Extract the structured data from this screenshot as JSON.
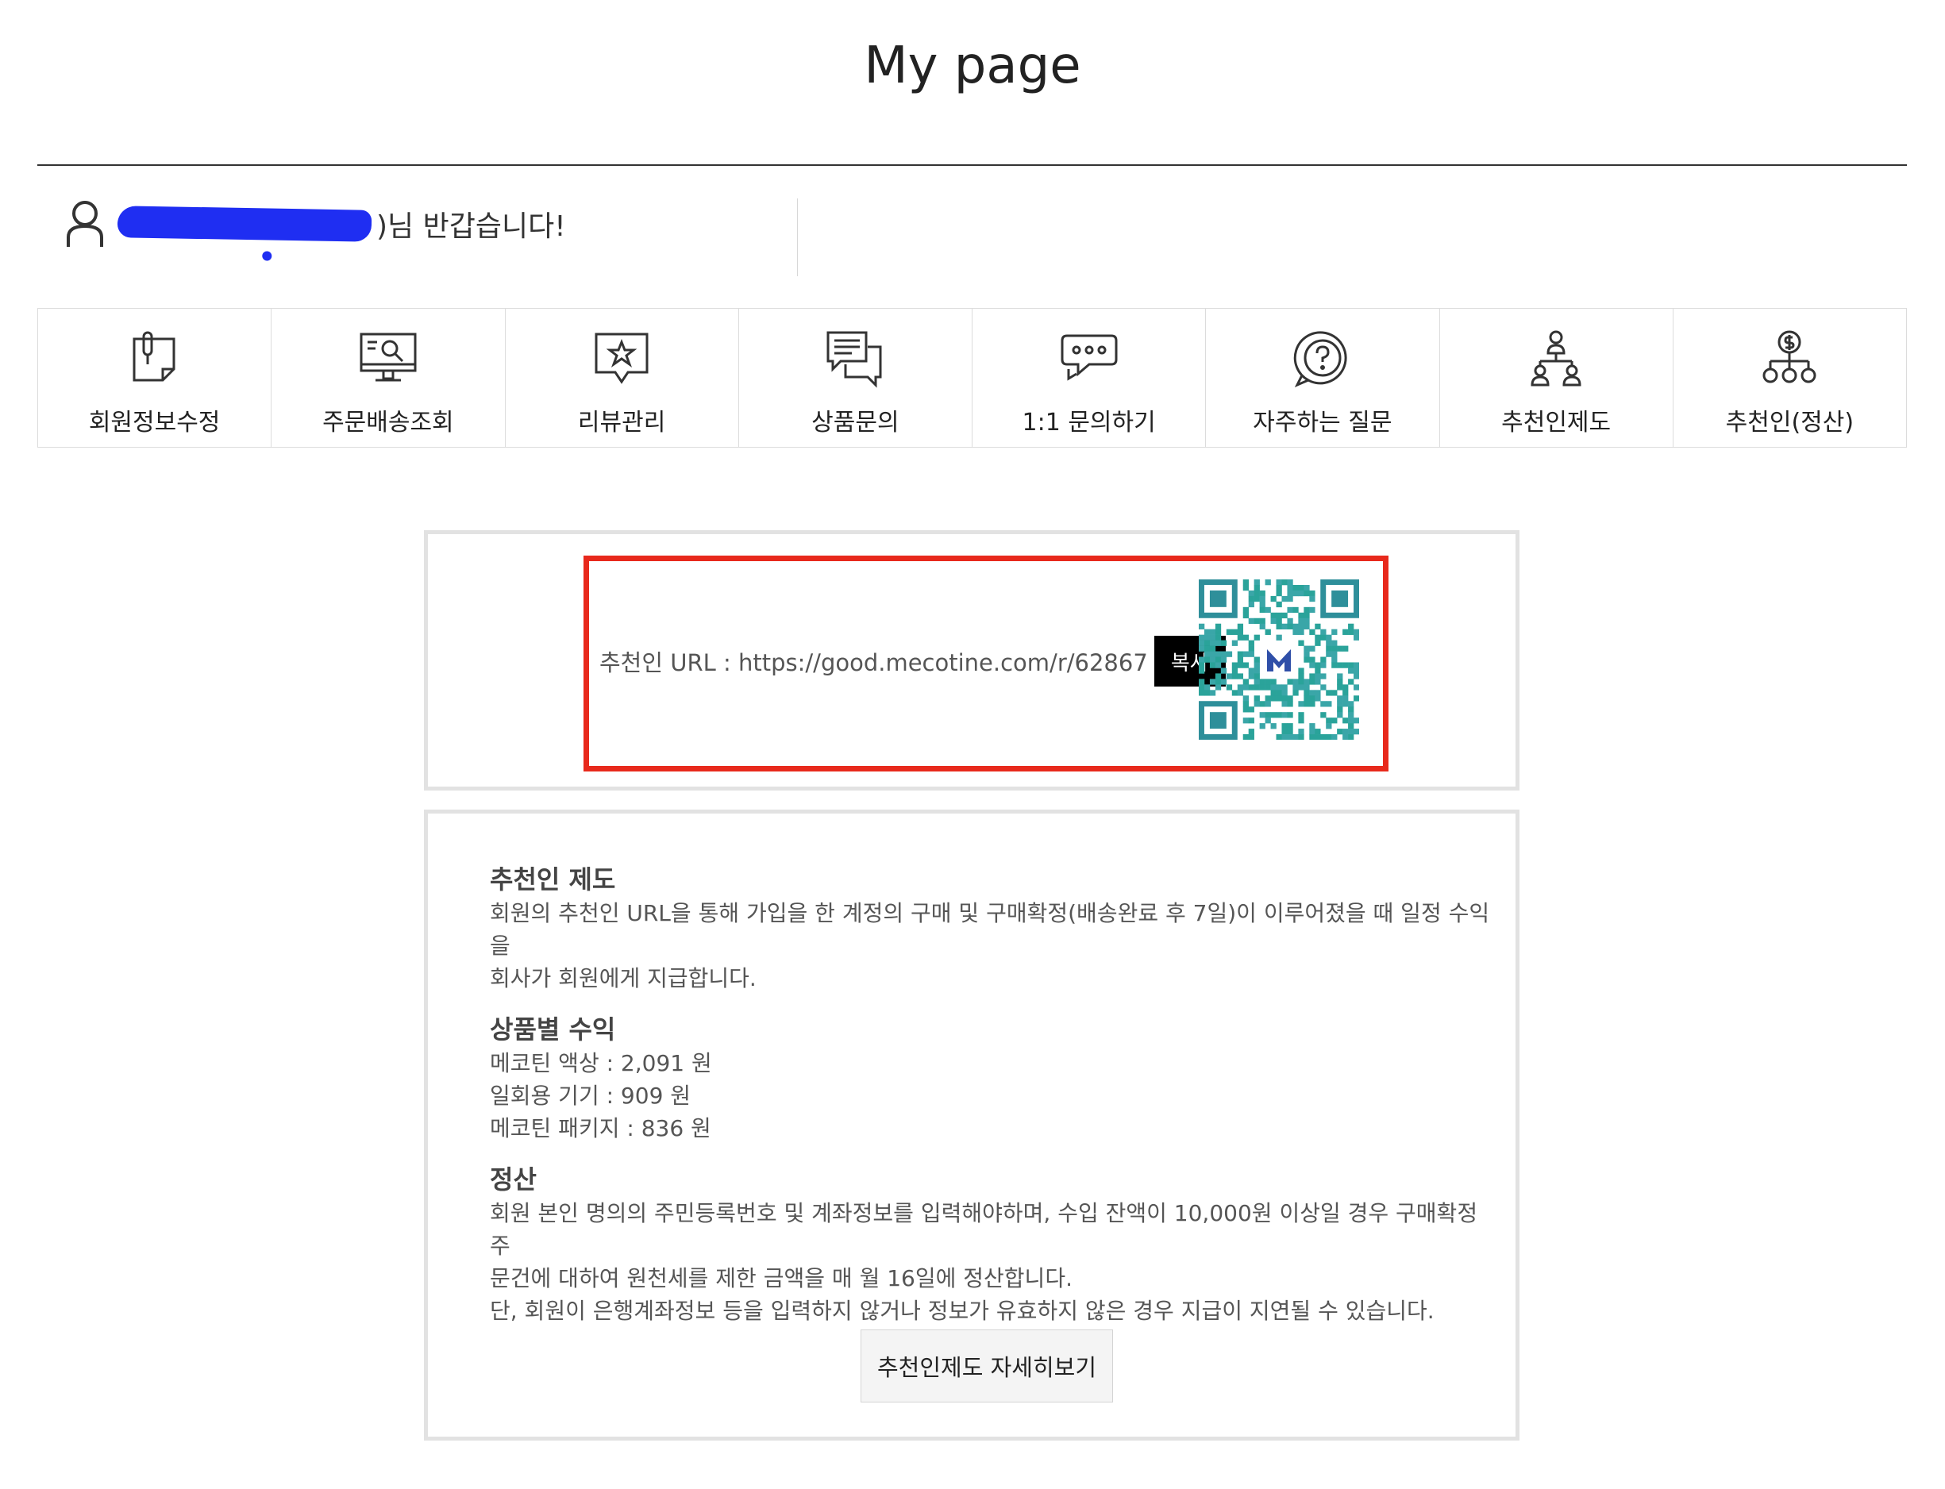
{
  "page": {
    "title": "My page"
  },
  "greeting": {
    "suffix": ")님 반갑습니다!"
  },
  "menu": {
    "items": [
      {
        "label": "회원정보수정",
        "icon": "member-edit-icon"
      },
      {
        "label": "주문배송조회",
        "icon": "order-search-icon"
      },
      {
        "label": "리뷰관리",
        "icon": "review-star-icon"
      },
      {
        "label": "상품문의",
        "icon": "product-inquiry-icon"
      },
      {
        "label": "1:1 문의하기",
        "icon": "chat-bubble-icon"
      },
      {
        "label": "자주하는 질문",
        "icon": "question-icon"
      },
      {
        "label": "추천인제도",
        "icon": "referral-tree-icon"
      },
      {
        "label": "추천인(정산)",
        "icon": "referral-settlement-icon"
      }
    ]
  },
  "referral": {
    "url_text": "추천인 URL : https://good.mecotine.com/r/62867",
    "copy_label": "복사",
    "highlight_color": "#e8291c"
  },
  "info": {
    "system_title": "추천인 제도",
    "system_desc_1": "회원의 추천인 URL을 통해 가입을 한 계정의 구매 및 구매확정(배송완료 후 7일)이 이루어졌을 때 일정 수익을",
    "system_desc_2": "회사가 회원에게 지급합니다.",
    "earnings_title": "상품별 수익",
    "earnings": [
      "메코틴 액상 : 2,091 원",
      "일회용 기기 : 909 원",
      "메코틴 패키지 : 836 원"
    ],
    "settlement_title": "정산",
    "settlement_1": "회원 본인 명의의 주민등록번호 및 계좌정보를 입력해야하며, 수입 잔액이 10,000원 이상일 경우 구매확정 주",
    "settlement_2": "문건에 대하여 원천세를 제한 금액을 매 월 16일에 정산합니다.",
    "settlement_3": "단, 회원이 은행계좌정보 등을 입력하지 않거나 정보가 유효하지 않은 경우 지급이 지연될 수 있습니다.",
    "detail_button": "추천인제도 자세히보기"
  }
}
